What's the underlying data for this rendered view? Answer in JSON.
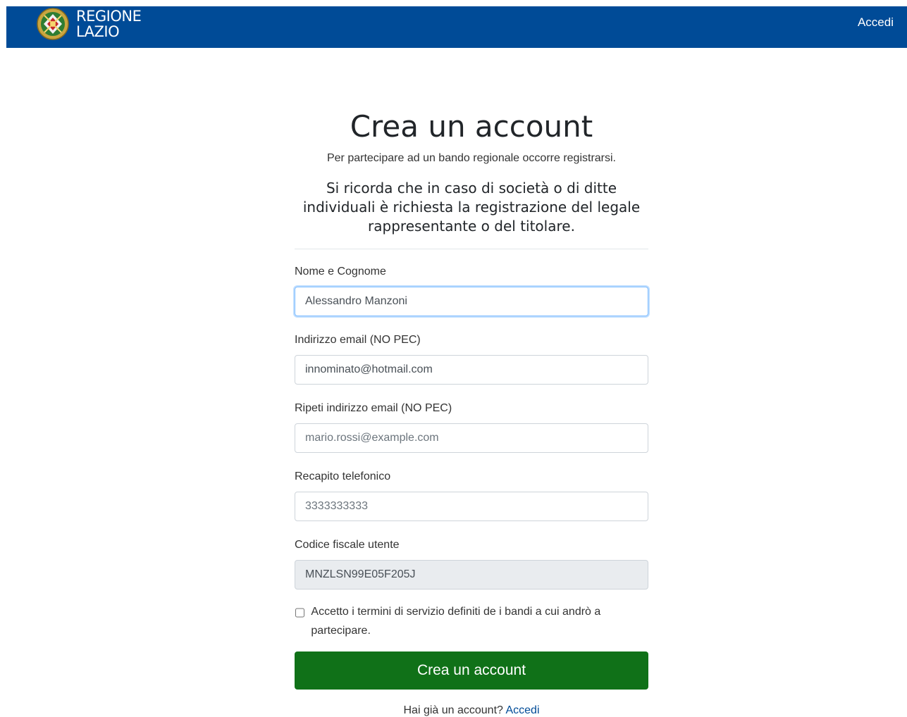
{
  "navbar": {
    "brand_line1": "REGIONE",
    "brand_line2": "LAZIO",
    "login_link": "Accedi",
    "background_color": "#004b97"
  },
  "main": {
    "title": "Crea un account",
    "subtitle": "Per partecipare ad un bando regionale occorre registrarsi.",
    "note": "Si ricorda che in caso di società o di ditte individuali è richiesta la registrazione del legale rappresentante o del titolare."
  },
  "form": {
    "name_label": "Nome e Cognome",
    "name_value": "Alessandro Manzoni",
    "email_label": "Indirizzo email (NO PEC)",
    "email_value": "innominato@hotmail.com",
    "email_repeat_label": "Ripeti indirizzo email (NO PEC)",
    "email_repeat_placeholder": "mario.rossi@example.com",
    "phone_label": "Recapito telefonico",
    "phone_placeholder": "3333333333",
    "fiscal_code_label": "Codice fiscale utente",
    "fiscal_code_value": "MNZLSN99E05F205J",
    "terms_label": "Accetto i termini di servizio definiti de i bandi a cui andrò a partecipare.",
    "terms_checked": false,
    "submit_label": "Crea un account",
    "submit_color": "#107118"
  },
  "footer": {
    "have_account_text": "Hai già un account?",
    "login_link": "Accedi"
  }
}
